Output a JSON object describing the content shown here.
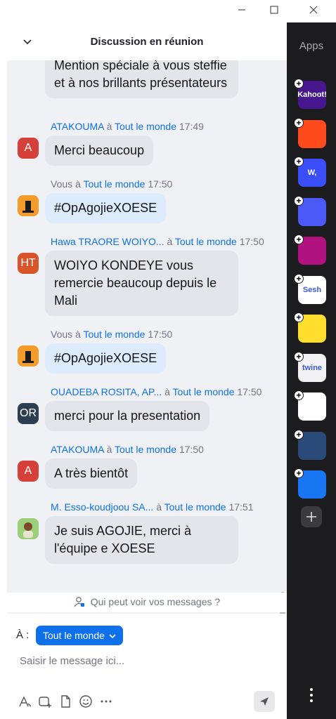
{
  "header": {
    "title": "Discussion en réunion"
  },
  "messages": [
    {
      "bubble": "Mention spéciale à vous steffie et à nos brillants présentateurs",
      "mine": false
    },
    {
      "sender": "ATAKOUMA",
      "to_word": "à",
      "recipient": "Tout le monde",
      "time": "17:49",
      "avatar": "A",
      "bubble": "Merci beaucoup",
      "mine": false
    },
    {
      "sender": "Vous",
      "to_word": "à",
      "recipient": "Tout le monde",
      "time": "17:50",
      "bubble": "#OpAgojieXOESE",
      "mine": true
    },
    {
      "sender": "Hawa TRAORE WOIYO...",
      "to_word": "à",
      "recipient": "Tout le monde",
      "time": "17:50",
      "avatar": "HT",
      "bubble": "WOIYO KONDEYE vous remercie beaucoup depuis le Mali",
      "mine": false
    },
    {
      "sender": "Vous",
      "to_word": "à",
      "recipient": "Tout le monde",
      "time": "17:50",
      "bubble": "#OpAgojieXOESE",
      "mine": true
    },
    {
      "sender": "OUADEBA ROSITA, AP...",
      "to_word": "à",
      "recipient": "Tout le monde",
      "time": "17:50",
      "avatar": "OR",
      "bubble": "merci pour la presentation",
      "mine": false
    },
    {
      "sender": "ATAKOUMA",
      "to_word": "à",
      "recipient": "Tout le monde",
      "time": "17:50",
      "avatar": "A",
      "bubble": "A très bientôt",
      "mine": false
    },
    {
      "sender": "M. Esso-koudjoou SA...",
      "to_word": "à",
      "recipient": "Tout le monde",
      "time": "17:51",
      "bubble": "Je suis AGOJIE, merci à l'équipe e XOESE",
      "mine": false
    }
  ],
  "privacy_note": "Qui peut voir vos messages ?",
  "composer": {
    "to_label": "À :",
    "recipient": "Tout le monde",
    "placeholder": "Saisir le message ici..."
  },
  "apps": {
    "title": "Apps",
    "items": [
      {
        "name": "Kahoot",
        "label": "Kahoot!",
        "color": "#46178f"
      },
      {
        "name": "Miro-like",
        "label": "",
        "color": "#ff4a1c"
      },
      {
        "name": "Wooclap",
        "label": "W,",
        "color": "#3a4ff7"
      },
      {
        "name": "Avatar",
        "label": "",
        "color": "#4b5af7"
      },
      {
        "name": "Stream",
        "label": "",
        "color": "#b0127f"
      },
      {
        "name": "Sesh",
        "label": "Sesh",
        "color": "#ffffff"
      },
      {
        "name": "Emoji",
        "label": "",
        "color": "#ffde2e"
      },
      {
        "name": "Twine",
        "label": "twine",
        "color": "#f2f2f4"
      },
      {
        "name": "Blocks",
        "label": "",
        "color": "#ffffff"
      },
      {
        "name": "Sync",
        "label": "",
        "color": "#2a4a7a"
      },
      {
        "name": "Flow",
        "label": "",
        "color": "#1976f2"
      }
    ]
  },
  "colors": {
    "accent": "#0e71eb",
    "bubble": "#e4e5ea",
    "mine_bubble": "#dcecfd",
    "sidebar": "#1c1c1e"
  }
}
